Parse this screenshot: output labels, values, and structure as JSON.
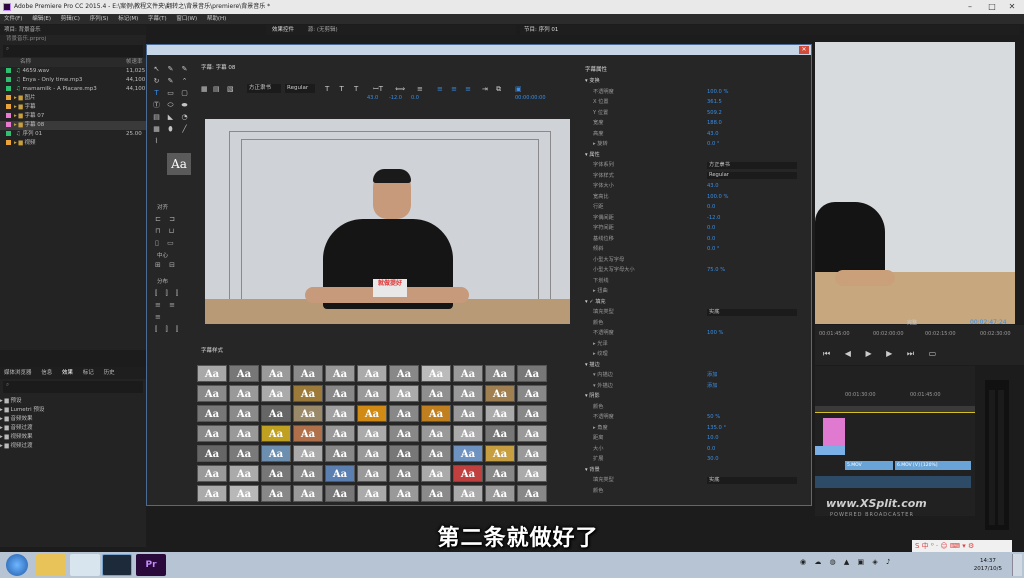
{
  "window": {
    "title": "Adobe Premiere Pro CC 2015.4 - E:\\案例\\教程文件夹\\翻转之\\背景音乐\\premiere\\背景音乐 *"
  },
  "menu": [
    "文件(F)",
    "编辑(E)",
    "剪辑(C)",
    "序列(S)",
    "标记(M)",
    "字幕(T)",
    "窗口(W)",
    "帮助(H)"
  ],
  "project": {
    "tab": "项目: 背景音乐",
    "file": "背景音乐.prproj",
    "col_name": "名称",
    "col_rate": "帧速率",
    "items": [
      {
        "name": "4659.wav",
        "rate": "11,025",
        "color": "#2fbf71"
      },
      {
        "name": "Enya - Only time.mp3",
        "rate": "44,100",
        "color": "#2fbf71"
      },
      {
        "name": "mamamilk - A Placare.mp3",
        "rate": "44,100",
        "color": "#2fbf71"
      },
      {
        "name": "图片",
        "rate": "",
        "color": "#e8a33a"
      },
      {
        "name": "字幕",
        "rate": "",
        "color": "#e8a33a"
      },
      {
        "name": "字幕 07",
        "rate": "",
        "color": "#e67bd0"
      },
      {
        "name": "字幕 08",
        "rate": "",
        "color": "#e67bd0"
      },
      {
        "name": "序列 01",
        "rate": "25.00",
        "color": "#2fbf71"
      },
      {
        "name": "视频",
        "rate": "",
        "color": "#e8a33a"
      }
    ]
  },
  "effects": {
    "tabs": [
      "媒体浏览器",
      "信息",
      "效果",
      "标记",
      "历史"
    ],
    "items": [
      "预设",
      "Lumetri 预设",
      "音频效果",
      "音频过渡",
      "视频效果",
      "视频过渡"
    ]
  },
  "source_tabs": {
    "effects_controls": "效果控件",
    "source": "源: (无剪辑)"
  },
  "program_tab": "节目: 序列 01",
  "titler": {
    "title_tab": "字幕: 字幕 08",
    "font_family": "方正隶书",
    "font_style": "Regular",
    "tool_vals": [
      "43.0",
      "-12.0",
      "0.0"
    ],
    "timecode": "00:00:00:00",
    "sections": {
      "align": "对齐",
      "center": "中心",
      "distribute": "分布"
    },
    "styles_tab": "字幕样式",
    "style_glyph": "Aa",
    "style_colors": [
      [
        "#a8a8a8",
        "#777",
        "#9a9a9a",
        "#8a8a8a",
        "#999",
        "#aaa",
        "#888",
        "#bbb",
        "#999",
        "#888",
        "#777"
      ],
      [
        "#8a8a8a",
        "#999",
        "#aaa",
        "#9b7a3a",
        "#888",
        "#999",
        "#aaa",
        "#8f8f8f",
        "#999",
        "#a08050",
        "#888"
      ],
      [
        "#777",
        "#8a8a8a",
        "#666",
        "#9a8a6a",
        "#a0a0a0",
        "#d18a14",
        "#888",
        "#c08020",
        "#999",
        "#aaa",
        "#888"
      ],
      [
        "#8a8a8a",
        "#999",
        "#c0a020",
        "#b0704a",
        "#999",
        "#aaa",
        "#888",
        "#999",
        "#aaa",
        "#777",
        "#999"
      ],
      [
        "#666",
        "#7a7a7a",
        "#6c8fb0",
        "#aaa",
        "#888",
        "#999",
        "#777",
        "#888",
        "#6f93c0",
        "#c89f40",
        "#999"
      ],
      [
        "#999",
        "#aaa",
        "#777",
        "#8a8a8a",
        "#5a7fb0",
        "#999",
        "#888",
        "#aaa",
        "#c04040",
        "#888",
        "#aaa"
      ],
      [
        "#aaa",
        "#b8b8b8",
        "#888",
        "#999",
        "#777",
        "#aaa",
        "#999",
        "#8a8a8a",
        "#aaa",
        "#999",
        "#888"
      ]
    ]
  },
  "properties": {
    "tab": "字幕属性",
    "rows": [
      {
        "t": "head",
        "label": "▾ 变换"
      },
      {
        "label": "不透明度",
        "value": "100.0 %"
      },
      {
        "label": "X 位置",
        "value": "361.5"
      },
      {
        "label": "Y 位置",
        "value": "509.2"
      },
      {
        "label": "宽度",
        "value": "188.0"
      },
      {
        "label": "高度",
        "value": "43.0"
      },
      {
        "label": "▸ 旋转",
        "value": "0.0 °"
      },
      {
        "t": "head",
        "label": "▾ 属性"
      },
      {
        "label": "字体系列",
        "select": "方正隶书"
      },
      {
        "label": "字体样式",
        "select": "Regular"
      },
      {
        "label": "字体大小",
        "value": "43.0"
      },
      {
        "label": "宽高比",
        "value": "100.0 %"
      },
      {
        "label": "行距",
        "value": "0.0"
      },
      {
        "label": "字偶间距",
        "value": "-12.0"
      },
      {
        "label": "字符间距",
        "value": "0.0"
      },
      {
        "label": "基线位移",
        "value": "0.0"
      },
      {
        "label": "倾斜",
        "value": "0.0 °"
      },
      {
        "label": "小型大写字母",
        "value": ""
      },
      {
        "label": "小型大写字母大小",
        "value": "75.0 %"
      },
      {
        "label": "下划线",
        "value": ""
      },
      {
        "label": "▸ 扭曲",
        "value": ""
      },
      {
        "t": "head",
        "label": "▾ ✓ 填充"
      },
      {
        "label": "填充类型",
        "select": "实底"
      },
      {
        "label": "颜色",
        "value": ""
      },
      {
        "label": "不透明度",
        "value": "100 %"
      },
      {
        "label": "▸  光泽",
        "value": ""
      },
      {
        "label": "▸  纹理",
        "value": ""
      },
      {
        "t": "head",
        "label": "▾ 描边"
      },
      {
        "label": "▾ 内描边",
        "value": "添加"
      },
      {
        "label": "▾ 外描边",
        "value": "添加"
      },
      {
        "t": "head",
        "label": "▾ 阴影"
      },
      {
        "label": "颜色",
        "value": ""
      },
      {
        "label": "不透明度",
        "value": "50 %"
      },
      {
        "label": "▸ 角度",
        "value": "135.0 °"
      },
      {
        "label": "距离",
        "value": "10.0"
      },
      {
        "label": "大小",
        "value": "0.0"
      },
      {
        "label": "扩展",
        "value": "30.0"
      },
      {
        "t": "head",
        "label": "▾ 背景"
      },
      {
        "label": "填充类型",
        "select": "实底"
      },
      {
        "label": "颜色",
        "value": ""
      }
    ]
  },
  "program": {
    "fit": "完整",
    "timecode": "00:02:47:24",
    "ruler": [
      "00:01:45:00",
      "00:02:00:00",
      "00:02:15:00",
      "00:02:30:00"
    ]
  },
  "timeline": {
    "ruler": [
      "00:01:30:00",
      "00:01:45:00"
    ],
    "clips": [
      "5.MOV",
      "6.MOV [V] [120%]"
    ]
  },
  "subtitle": "第二条就做好了",
  "canvas_caption": "就做提好",
  "watermark": {
    "brand": "www.XSplit.com",
    "tag": "POWERED BROADCASTER"
  },
  "taskbar": {
    "time": "14:37",
    "date": "2017/10/5"
  }
}
